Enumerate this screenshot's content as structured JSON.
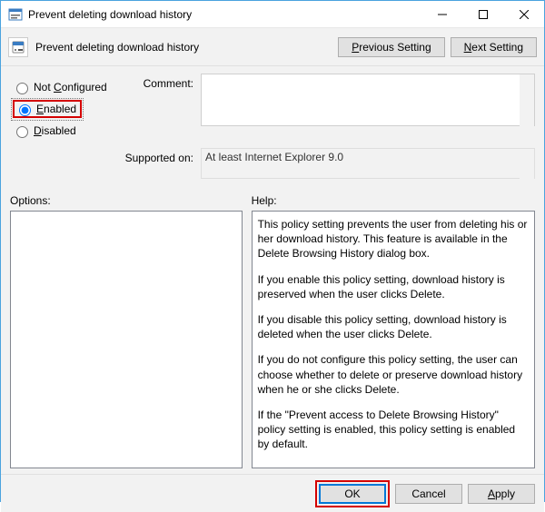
{
  "title": "Prevent deleting download history",
  "header": {
    "title": "Prevent deleting download history",
    "previous_label": "Previous Setting",
    "next_label": "Next Setting"
  },
  "radios": {
    "not_configured": "Not Configured",
    "enabled": "Enabled",
    "disabled": "Disabled",
    "selected": "enabled"
  },
  "labels": {
    "comment": "Comment:",
    "supported": "Supported on:",
    "options": "Options:",
    "help": "Help:"
  },
  "comment_value": "",
  "supported_value": "At least Internet Explorer 9.0",
  "help": {
    "p1": "This policy setting prevents the user from deleting his or her download history. This feature is available in the Delete Browsing History dialog box.",
    "p2": "If you enable this policy setting, download history is preserved when the user clicks Delete.",
    "p3": "If you disable this policy setting, download history is deleted when the user clicks Delete.",
    "p4": "If you do not configure this policy setting, the user can choose whether to delete or preserve download history when he or she clicks Delete.",
    "p5": "If the \"Prevent access to Delete Browsing History\" policy setting is enabled, this policy setting is enabled by default."
  },
  "footer": {
    "ok": "OK",
    "cancel": "Cancel",
    "apply": "Apply"
  }
}
